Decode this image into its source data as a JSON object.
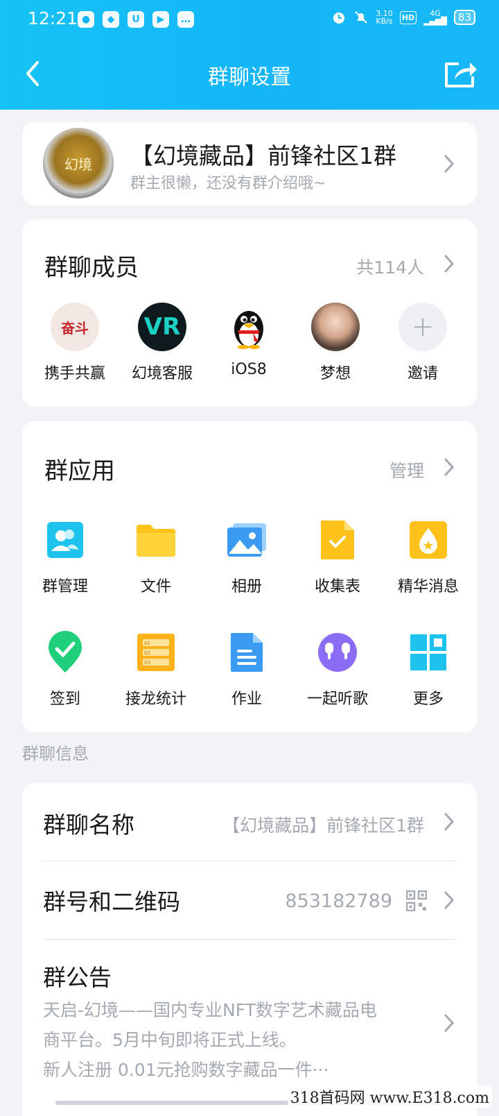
{
  "status_bar": {
    "time": "12:21",
    "net_speed_value": "3.10",
    "net_speed_unit": "KB/s",
    "hd": "HD",
    "signal": "4G",
    "battery": "83"
  },
  "nav": {
    "title": "群聊设置",
    "back_icon": "chevron-left-icon",
    "share_icon": "share-icon"
  },
  "group": {
    "avatar_text": "幻境",
    "name": "【幻境藏品】前锋社区1群",
    "description": "群主很懒，还没有群介绍哦~"
  },
  "members": {
    "title": "群聊成员",
    "count": "共114人",
    "list": [
      {
        "name": "携手共赢",
        "avatar_text": "奋斗"
      },
      {
        "name": "幻境客服",
        "avatar_text": "VR"
      },
      {
        "name": "iOS8",
        "avatar_text": ""
      },
      {
        "name": "梦想",
        "avatar_text": ""
      },
      {
        "name": "邀请",
        "avatar_text": "+"
      }
    ]
  },
  "apps": {
    "title": "群应用",
    "manage": "管理",
    "items": [
      {
        "name": "群管理",
        "icon": "group-manage-icon"
      },
      {
        "name": "文件",
        "icon": "folder-icon"
      },
      {
        "name": "相册",
        "icon": "album-icon"
      },
      {
        "name": "收集表",
        "icon": "form-icon"
      },
      {
        "name": "精华消息",
        "icon": "essence-icon"
      },
      {
        "name": "签到",
        "icon": "checkin-icon"
      },
      {
        "name": "接龙统计",
        "icon": "relay-icon"
      },
      {
        "name": "作业",
        "icon": "homework-icon"
      },
      {
        "name": "一起听歌",
        "icon": "headphones-icon"
      },
      {
        "name": "更多",
        "icon": "more-grid-icon"
      }
    ],
    "relay_icon_text": [
      "01",
      "02",
      "03"
    ]
  },
  "info": {
    "section_label": "群聊信息",
    "name_title": "群聊名称",
    "name_value": "【幻境藏品】前锋社区1群",
    "number_title": "群号和二维码",
    "number_value": "853182789",
    "notice_title": "群公告",
    "notice_lines": [
      "天启-幻境——国内专业NFT数字艺术藏品电",
      "商平台。5月中旬即将正式上线。",
      "新人注册 0.01元抢购数字藏品一件···"
    ]
  },
  "watermark": "318首码网 www.E318.com",
  "colors": {
    "header": "#16b8f6",
    "background": "#f1f3f7",
    "secondary_text": "#a5a9b1"
  }
}
